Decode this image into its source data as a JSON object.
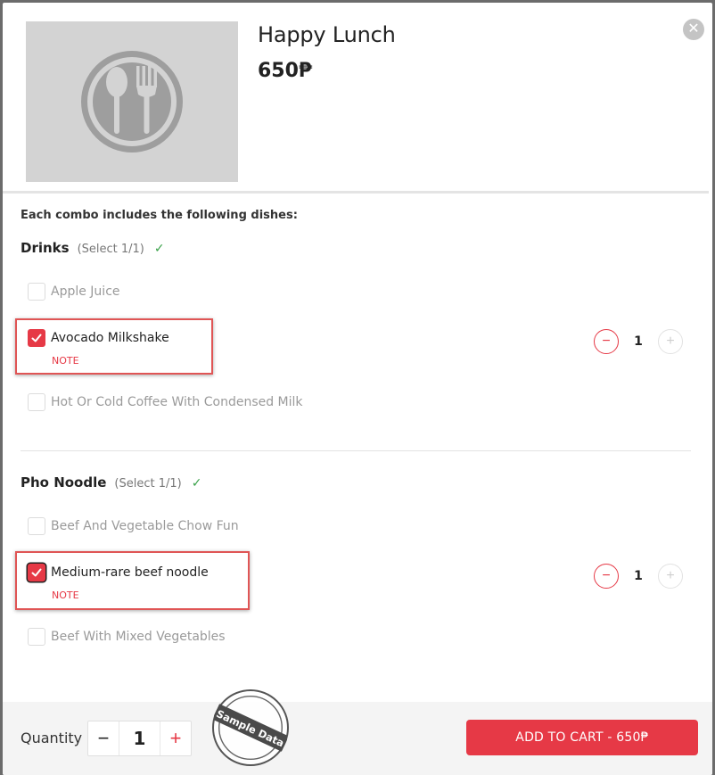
{
  "product": {
    "title": "Happy Lunch",
    "price": "650₱",
    "image_icon": "spoon-fork-plate-icon"
  },
  "close_icon": "close-icon",
  "intro": "Each combo includes the following dishes:",
  "groups": [
    {
      "name": "Drinks",
      "rule": "(Select 1/1)",
      "status_icon": "check-icon",
      "options": [
        {
          "label": "Apple Juice",
          "checked": false
        },
        {
          "label": "Avocado Milkshake",
          "checked": true,
          "note": "NOTE",
          "quantity": "1"
        },
        {
          "label": "Hot Or Cold Coffee With Condensed Milk",
          "checked": false
        }
      ]
    },
    {
      "name": "Pho Noodle",
      "rule": "(Select 1/1)",
      "status_icon": "check-icon",
      "options": [
        {
          "label": "Beef And Vegetable Chow Fun",
          "checked": false
        },
        {
          "label": "Medium-rare beef noodle",
          "checked": true,
          "note": "NOTE",
          "quantity": "1"
        },
        {
          "label": "Beef With Mixed Vegetables",
          "checked": false
        }
      ]
    }
  ],
  "footer": {
    "quantity_label": "Quantity",
    "quantity_value": "1",
    "decrement": "−",
    "increment": "+",
    "add_to_cart": "ADD TO CART - 650₱"
  },
  "stamp_text": "Sample Data",
  "colors": {
    "accent": "#e63946",
    "check_green": "#3aa24a",
    "highlight_red": "#e05555",
    "image_bg": "#d3d3d3"
  }
}
